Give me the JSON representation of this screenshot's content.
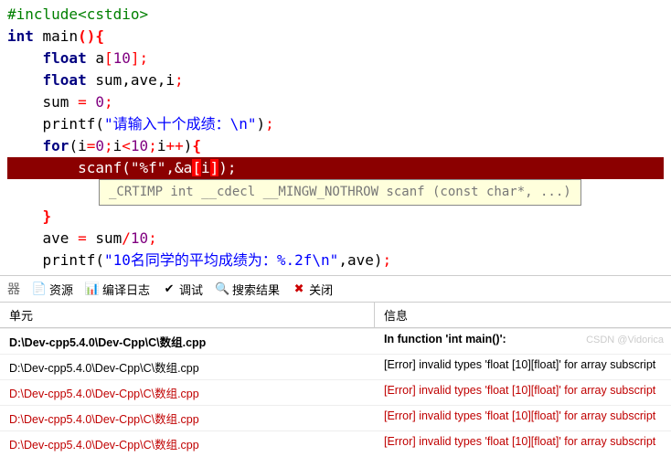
{
  "code": {
    "l1_include": "#include<cstdio>",
    "l2_int": "int",
    "l2_rest": " main",
    "l2_paren": "()",
    "l2_brace": "{",
    "l3_indent": "    ",
    "l3_type": "float",
    "l3_rest": " a",
    "l3_bracket": "[",
    "l3_num": "10",
    "l3_bracket2": "];",
    "l4_indent": "    ",
    "l4_type": "float",
    "l4_rest": " sum,ave,i",
    "l4_semi": ";",
    "l5_indent": "    ",
    "l5_lhs": "sum ",
    "l5_eq": "=",
    "l5_sp": " ",
    "l5_num": "0",
    "l5_semi": ";",
    "l6_indent": "    ",
    "l6_func": "printf",
    "l6_paren1": "(",
    "l6_str": "\"请输入十个成绩：\\n\"",
    "l6_paren2": ")",
    "l6_semi": ";",
    "l7_indent": "    ",
    "l7_for": "for",
    "l7_paren1": "(",
    "l7_i": "i",
    "l7_eq": "=",
    "l7_n0": "0",
    "l7_s1": ";",
    "l7_i2": "i",
    "l7_lt": "<",
    "l7_n10": "10",
    "l7_s2": ";",
    "l7_i3": "i",
    "l7_pp": "++",
    "l7_paren2": ")",
    "l7_brace": "{",
    "l8_indent": "        ",
    "l8_func": "scanf",
    "l8_paren1": "(",
    "l8_str": "\"%f\"",
    "l8_comma": ",",
    "l8_amp": "&a",
    "l8_br1": "[",
    "l8_i": "i",
    "l8_br2": "]",
    "l8_paren2": ")",
    "l8_semi": ";",
    "tooltip": "_CRTIMP int __cdecl __MINGW_NOTHROW scanf (const char*, ...)",
    "l9_indent": "    ",
    "l9_brace": "}",
    "l10_indent": "    ",
    "l10_lhs": "ave ",
    "l10_eq": "=",
    "l10_sp": " sum",
    "l10_div": "/",
    "l10_num": "10",
    "l10_semi": ";",
    "l11_indent": "    ",
    "l11_func": "printf",
    "l11_paren1": "(",
    "l11_str": "\"10名同学的平均成绩为：%.2f\\n\"",
    "l11_comma": ",ave",
    "l11_paren2": ")",
    "l11_semi": ";"
  },
  "tabs": {
    "compiler": "器",
    "resources": "资源",
    "compile_log": "编译日志",
    "debug": "调试",
    "search": "搜索结果",
    "close": "关闭"
  },
  "panel": {
    "col_unit": "单元",
    "col_msg": "信息",
    "rows": [
      {
        "unit": "D:\\Dev-cpp5.4.0\\Dev-Cpp\\C\\数组.cpp",
        "msg": "In function 'int main()':",
        "bold": true,
        "error": false
      },
      {
        "unit": "D:\\Dev-cpp5.4.0\\Dev-Cpp\\C\\数组.cpp",
        "msg": "[Error] invalid types 'float [10][float]' for array subscript",
        "bold": false,
        "error": false
      },
      {
        "unit": "D:\\Dev-cpp5.4.0\\Dev-Cpp\\C\\数组.cpp",
        "msg": "[Error] invalid types 'float [10][float]' for array subscript",
        "bold": false,
        "error": true
      },
      {
        "unit": "D:\\Dev-cpp5.4.0\\Dev-Cpp\\C\\数组.cpp",
        "msg": "[Error] invalid types 'float [10][float]' for array subscript",
        "bold": false,
        "error": true
      },
      {
        "unit": "D:\\Dev-cpp5.4.0\\Dev-Cpp\\C\\数组.cpp",
        "msg": "[Error] invalid types 'float [10][float]' for array subscript",
        "bold": false,
        "error": true
      }
    ]
  },
  "watermark": "CSDN @Vidorica"
}
